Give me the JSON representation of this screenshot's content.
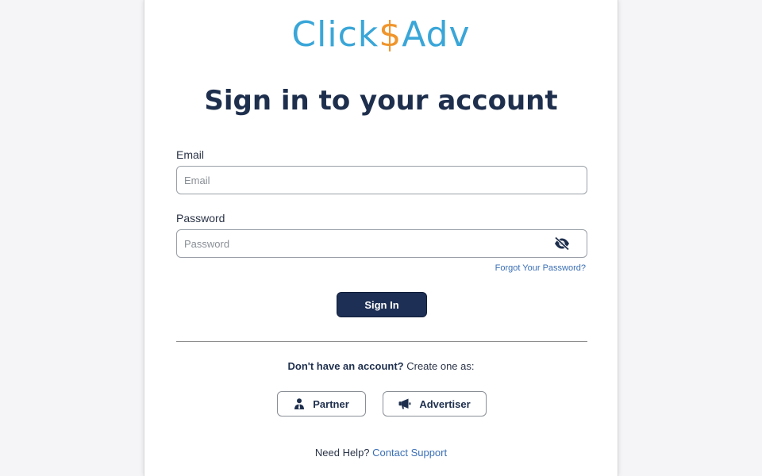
{
  "logo": {
    "part1": "Click",
    "dollar": "$",
    "part2": "Adv"
  },
  "heading": "Sign in to your account",
  "email": {
    "label": "Email",
    "placeholder": "Email",
    "value": ""
  },
  "password": {
    "label": "Password",
    "placeholder": "Password",
    "value": "",
    "toggle_icon": "eye-slash-icon"
  },
  "forgot_link": "Forgot Your Password?",
  "signin_button": "Sign In",
  "signup": {
    "question": "Don't have an account?",
    "prompt": " Create one as:",
    "partner_label": "Partner",
    "partner_icon": "user-tie-icon",
    "advertiser_label": "Advertiser",
    "advertiser_icon": "megaphone-icon"
  },
  "help": {
    "text": "Need Help? ",
    "link": "Contact Support"
  },
  "colors": {
    "brand_blue": "#3aa6d8",
    "brand_orange": "#f0952b",
    "primary": "#1e2f55",
    "link": "#3a6fb5"
  }
}
